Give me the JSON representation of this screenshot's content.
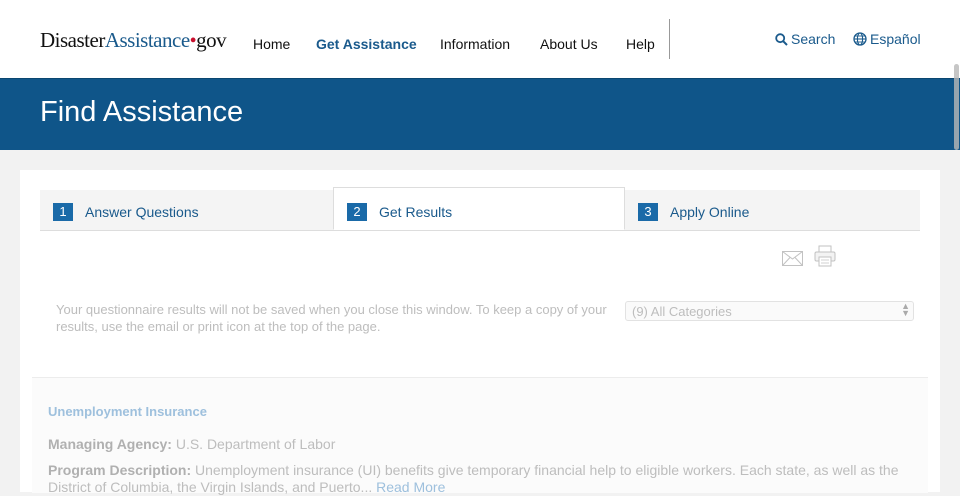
{
  "header": {
    "logo": {
      "part1": "Disaster",
      "part2": "Assistance",
      "part3": "gov"
    },
    "nav": [
      "Home",
      "Get Assistance",
      "Information",
      "About Us",
      "Help"
    ],
    "active_nav": "Get Assistance",
    "search_label": "Search",
    "language_label": "Español"
  },
  "banner": {
    "title": "Find Assistance"
  },
  "steps": [
    {
      "num": "1",
      "label": "Answer Questions"
    },
    {
      "num": "2",
      "label": "Get Results",
      "current": true
    },
    {
      "num": "3",
      "label": "Apply Online"
    }
  ],
  "results": {
    "notice": "Your questionnaire results will not be saved when you close this window. To keep a copy of your results, use the email or print icon at the top of the page.",
    "category_select": "(9) All Categories",
    "item": {
      "title": "Unemployment Insurance",
      "agency_label": "Managing Agency:",
      "agency_value": "U.S. Department of Labor",
      "description_label": "Program Description:",
      "description_value": "Unemployment insurance (UI) benefits give temporary financial help to eligible workers. Each state, as well as the District of Columbia, the Virgin Islands, and Puerto...",
      "read_more": "Read More"
    }
  },
  "icons": [
    "search-icon",
    "globe-icon",
    "email-icon",
    "print-icon"
  ],
  "colors": {
    "brand_blue": "#0f5589",
    "link_blue": "#1a5a8c",
    "step_blue": "#1a6aa8"
  }
}
